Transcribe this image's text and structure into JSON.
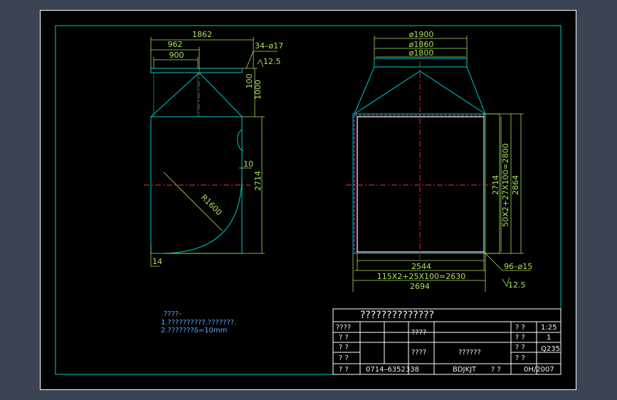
{
  "left_view": {
    "dim_total_width": "1862",
    "dim_flange_outer": "962",
    "dim_flange_inner": "900",
    "dim_holes": "34–ø17",
    "dim_roughness": "12.5",
    "dim_flange_height": "100",
    "dim_hopper_height": "1000",
    "dim_body_height": "2714",
    "dim_offset": "10",
    "dim_radius": "R1600",
    "dim_plate": "14"
  },
  "right_view": {
    "dim_d1": "ø1900",
    "dim_d2": "ø1860",
    "dim_d3": "ø1800",
    "dim_inner_height": "2714",
    "dim_hole_pitch_v": "50X2+27X100=2800",
    "dim_outer_height": "2864",
    "dim_inner_width": "2544",
    "dim_hole_pitch_h": "115X2+25X100=2630",
    "dim_outer_width": "2694",
    "dim_holes": "96–ø15",
    "dim_roughness": "12.5"
  },
  "notes": {
    "heading": "????-",
    "line1": "1.??????????.???????.",
    "line2": "2.???????δ=10mm"
  },
  "title_block": {
    "title": "??????????????",
    "cells": {
      "r1_label": "????",
      "r1_mid": "????",
      "r1_q": "? ?",
      "r1_scale": "1:25",
      "r2_a": "? ?",
      "r2_q": "? ?",
      "r2_qty": "1",
      "r3_a": "? ?",
      "r3_mid": "????",
      "r3_name": "??????",
      "r3_q": "? ?",
      "r3_mat": "Q235",
      "r4_a": "? ?",
      "r4_q": "? ?",
      "r5_a": "? ?",
      "r5_drawing_no": "0714–6352338",
      "r5_code": "BDJKJT",
      "r5_q": "? ?",
      "r5_date": "0H/2007"
    }
  },
  "colors": {
    "background": "#3b4453",
    "paper": "#000000",
    "frame": "#ffffff",
    "border": "#00c8c8",
    "geometry": "#00c8c8",
    "dimension": "#a8e35a",
    "centerline": "#ff2a2a",
    "hidden": "#ff66ff",
    "note_text": "#5fa8ff",
    "titleblock_text": "#f2f2f2"
  }
}
